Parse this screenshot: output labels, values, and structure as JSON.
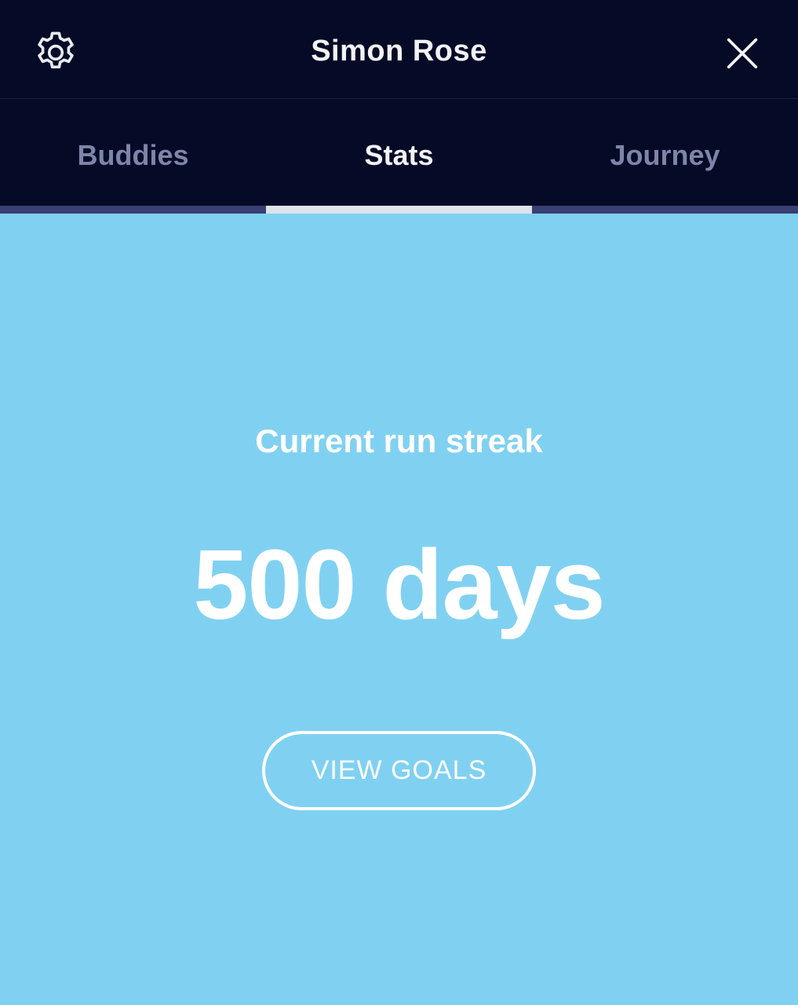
{
  "header": {
    "title": "Simon Rose",
    "settings_icon": "gear-icon",
    "close_icon": "close-icon"
  },
  "tabs": [
    {
      "label": "Buddies",
      "active": false
    },
    {
      "label": "Stats",
      "active": true
    },
    {
      "label": "Journey",
      "active": false
    }
  ],
  "stats": {
    "streak_label": "Current run streak",
    "streak_value": "500 days",
    "view_goals_label": "VIEW GOALS"
  },
  "colors": {
    "header_bg": "#050a26",
    "content_bg": "#80d1f1",
    "active_tab_text": "#f2f3f7",
    "inactive_tab_text": "#7d85a8",
    "indicator": "#dfe3ea",
    "indicator_track": "#383f72"
  }
}
